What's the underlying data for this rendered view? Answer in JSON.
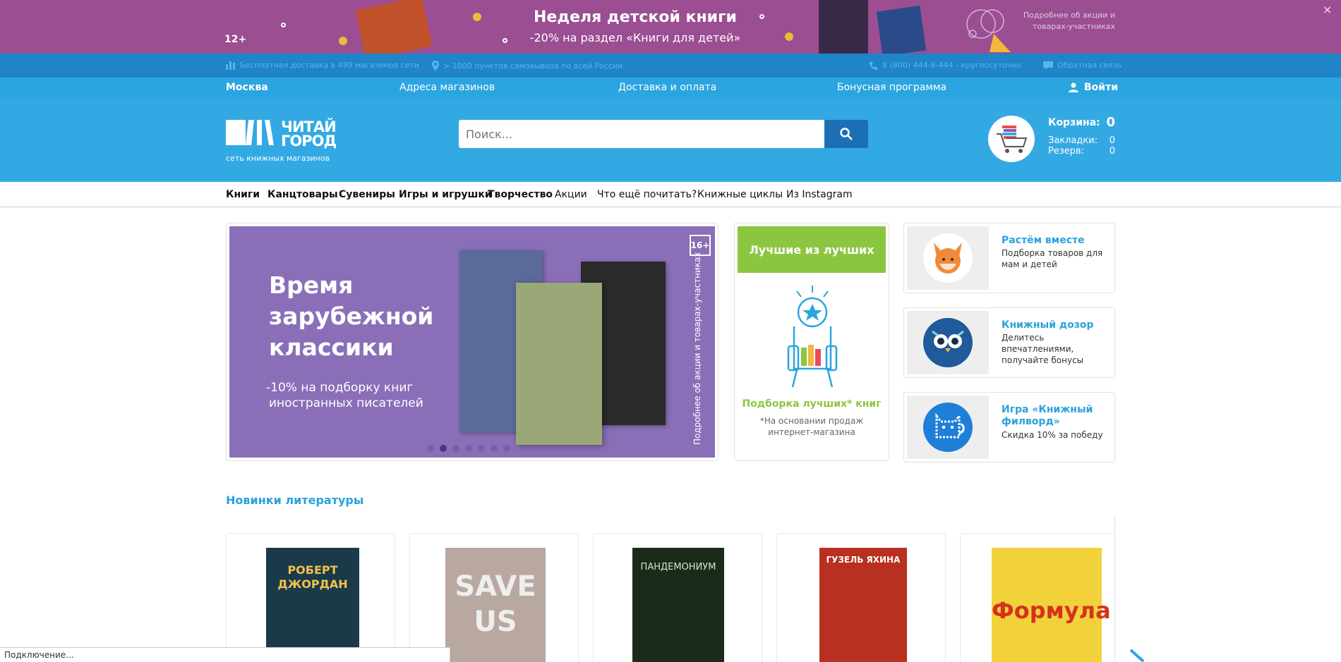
{
  "promo": {
    "age": "12+",
    "title": "Неделя детской книги",
    "subtitle": "-20% на раздел «Книги для детей»",
    "more": "Подробнее об акции и товарах-участниках",
    "close": "×",
    "color": "#9b4e92"
  },
  "infobar": {
    "delivery": "Бесплатная доставка в 499 магазинов сети",
    "pickup": "> 1000 пунктов самовывоза по всей России",
    "phone": "8 (800) 444-8-444 - круглосуточно",
    "feedback": "Обратная связь"
  },
  "navbar": {
    "city": "Москва",
    "addresses": "Адреса магазинов",
    "delivery": "Доставка и оплата",
    "bonus": "Бонусная программа",
    "login": "Войти"
  },
  "header": {
    "logo_word_1": "ЧИТАЙ",
    "logo_word_2": "ГОРОД",
    "logo_tagline": "сеть книжных магазинов",
    "search_placeholder": "Поиск...",
    "cart_label": "Корзина:",
    "cart_count": "0",
    "bookmarks_label": "Закладки:",
    "bookmarks_count": "0",
    "reserve_label": "Резерв:",
    "reserve_count": "0",
    "color": "#33a9e3"
  },
  "categories": [
    {
      "label": "Книги",
      "bold": true
    },
    {
      "label": "Канцтовары",
      "bold": true
    },
    {
      "label": "Сувениры",
      "bold": true
    },
    {
      "label": "Игры и игрушки",
      "bold": true
    },
    {
      "label": "Творчество",
      "bold": true
    },
    {
      "label": "Акции",
      "bold": false
    },
    {
      "label": "Что ещё почитать?",
      "bold": false
    },
    {
      "label": "Книжные циклы",
      "bold": false
    },
    {
      "label": "Из Instagram",
      "bold": false
    }
  ],
  "slider": {
    "heading_1": "Время",
    "heading_2": "зарубежной",
    "heading_3": "классики",
    "desc_1": "-10% на подборку книг",
    "desc_2": "иностранных писателей",
    "age": "16+",
    "side_text": "Подробнее об акции и товарах-участниках",
    "active_dot": 1,
    "dot_count": 7,
    "color": "#8a6fb8"
  },
  "best": {
    "title": "Лучшие из лучших",
    "caption": "Подборка лучших* книг",
    "note_1": "*На основании продаж",
    "note_2": "интернет-магазина"
  },
  "cards": [
    {
      "title": "Растём вместе",
      "sub_1": "Подборка товаров для",
      "sub_2": "мам и детей"
    },
    {
      "title": "Книжный дозор",
      "sub_1": "Делитесь впечатлениями,",
      "sub_2": "получайте бонусы"
    },
    {
      "title_1": "Игра «Книжный",
      "title_2": "филворд»",
      "sub_1": "Скидка 10% за победу"
    }
  ],
  "section": {
    "title": "Новинки литературы"
  },
  "products": [
    {
      "cover_color": "#1a3a4a",
      "title": "РОБЕРТ ДЖОРДАН"
    },
    {
      "cover_color": "#b8a8a0",
      "title": "SAVE US"
    },
    {
      "cover_color": "#1c2a1c",
      "title": "ПАНДЕМОНИУМ"
    },
    {
      "cover_color": "#b83020",
      "title": "ГУЗЕЛЬ ЯХИНА"
    },
    {
      "cover_color": "#f2d23a",
      "title": "Формула"
    }
  ],
  "status": {
    "text": "Подключение..."
  }
}
